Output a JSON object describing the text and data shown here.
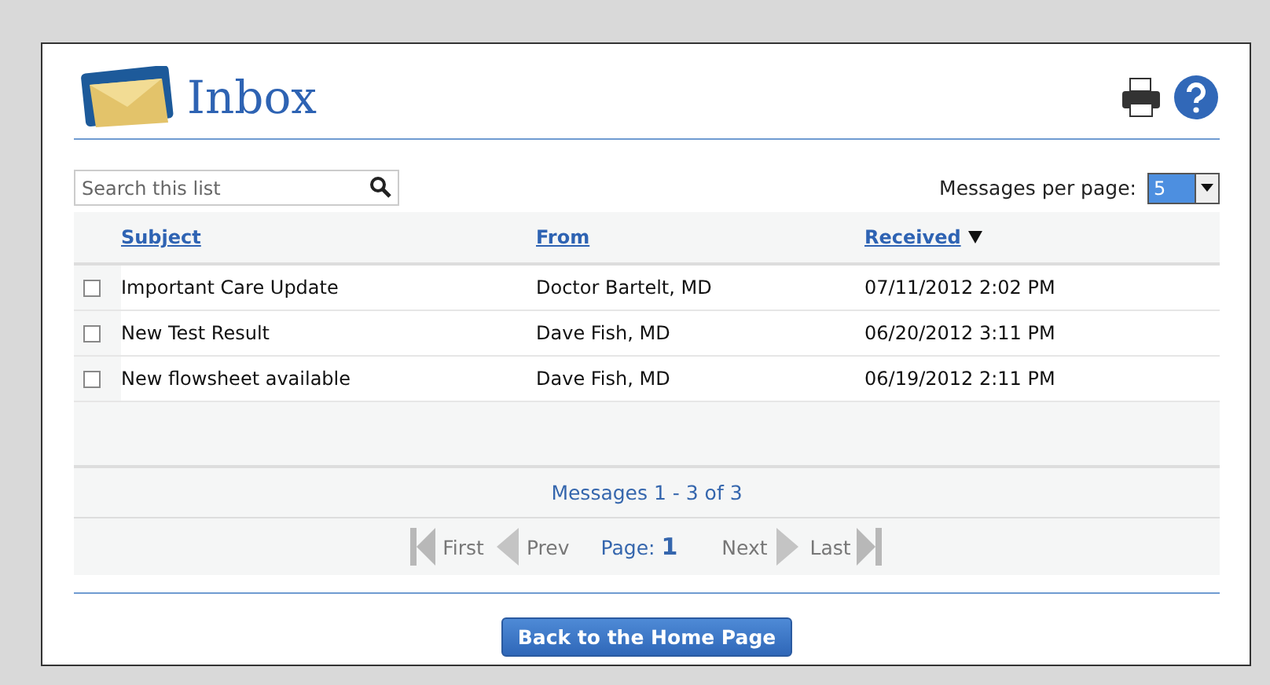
{
  "header": {
    "title": "Inbox"
  },
  "search": {
    "placeholder": "Search this list"
  },
  "per_page": {
    "label": "Messages per page:",
    "value": "5"
  },
  "table": {
    "columns": [
      {
        "label": "Subject",
        "sorted": false
      },
      {
        "label": "From",
        "sorted": false
      },
      {
        "label": "Received",
        "sorted": true
      }
    ],
    "rows": [
      {
        "checked": false,
        "cells": [
          "Important Care Update",
          "Doctor Bartelt, MD",
          "07/11/2012 2:02 PM"
        ]
      },
      {
        "checked": false,
        "cells": [
          "New Test Result",
          "Dave Fish, MD",
          "06/20/2012 3:11 PM"
        ]
      },
      {
        "checked": false,
        "cells": [
          "New flowsheet available",
          "Dave Fish, MD",
          "06/19/2012 2:11 PM"
        ]
      }
    ]
  },
  "summary": "Messages 1 - 3 of 3",
  "pager": {
    "page_label": "Page:",
    "page": "1",
    "before": [
      {
        "kind": "first",
        "label": "First"
      },
      {
        "kind": "prev",
        "label": "Prev"
      }
    ],
    "after": [
      {
        "kind": "next",
        "label": "Next"
      },
      {
        "kind": "last",
        "label": "Last"
      }
    ]
  },
  "footer_button": "Back to the Home Page"
}
